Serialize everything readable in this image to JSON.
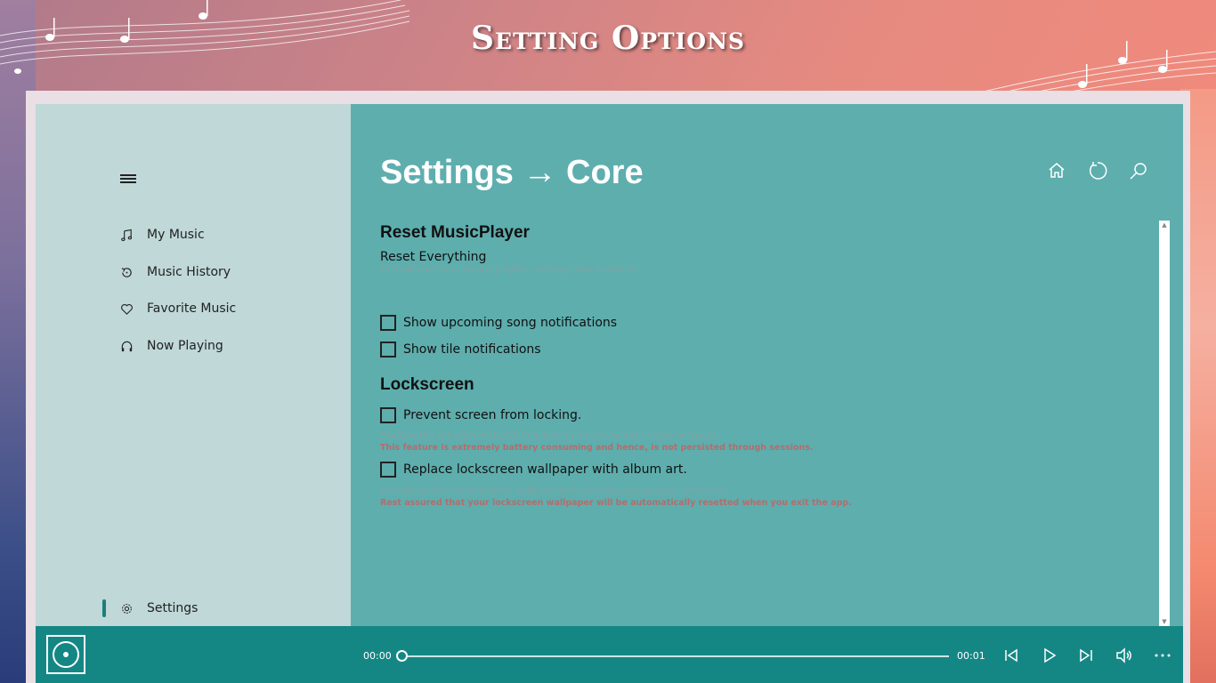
{
  "banner": {
    "title": "Setting Options"
  },
  "sidebar": {
    "items": [
      {
        "label": "My Music",
        "icon": "music-note-icon"
      },
      {
        "label": "Music History",
        "icon": "history-icon"
      },
      {
        "label": "Favorite Music",
        "icon": "heart-icon"
      },
      {
        "label": "Now Playing",
        "icon": "headphones-icon"
      }
    ],
    "settings": {
      "label": "Settings",
      "icon": "gear-icon"
    }
  },
  "main": {
    "title": "Settings → Core",
    "reset_section": {
      "heading": "Reset MusicPlayer",
      "link": "Reset Everything",
      "hint": "This will reset your library, playlists, settings, play history etc."
    },
    "notifications": {
      "upcoming": "Show upcoming song notifications",
      "tile": "Show tile notifications"
    },
    "lockscreen": {
      "heading": "Lockscreen",
      "prevent_label": "Prevent screen from locking.",
      "prevent_hint": "Enabling this will prevent the OS from locking the screen after regular intervals.",
      "prevent_warn": "This feature is extremely battery consuming and hence, is not persisted through sessions.",
      "wallpaper_label": "Replace lockscreen wallpaper with album art.",
      "wallpaper_hint": "This will replace the lockscreen wallpaper with currently playing song's album art.",
      "wallpaper_warn": "Rest assured that your lockscreen wallpaper will be automatically resetted when you exit the app."
    }
  },
  "player": {
    "current_time": "00:00",
    "total_time": "00:01",
    "progress": 0
  },
  "colors": {
    "sidebar_bg": "#c0d8d8",
    "main_bg": "#5eaeae",
    "player_bg": "#148785",
    "accent": "#1a7f7d"
  }
}
